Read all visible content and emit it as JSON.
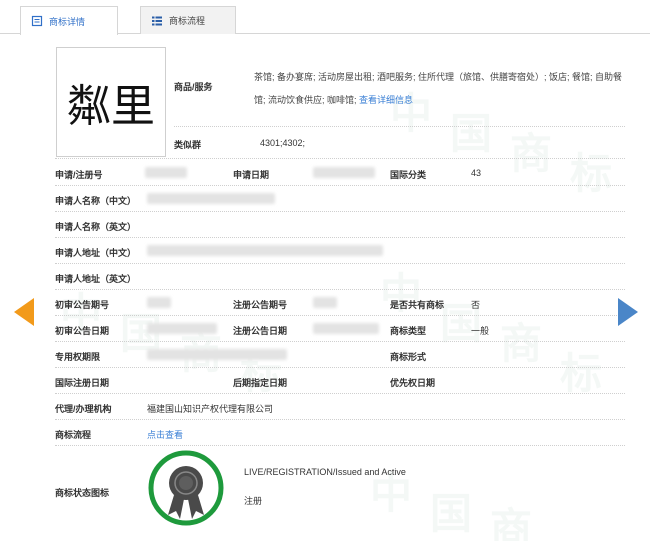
{
  "tabs": [
    {
      "label": "商标详情",
      "active": true
    },
    {
      "label": "商标流程",
      "active": false
    }
  ],
  "logo": {
    "text": "粼里"
  },
  "goods": {
    "label": "商品/服务",
    "text": "茶馆; 备办宴席; 活动房屋出租; 酒吧服务; 住所代理（旅馆、供膳寄宿处）; 饭店; 餐馆; 自助餐馆; 流动饮食供应; 咖啡馆; ",
    "link": "查看详细信息"
  },
  "similar_group": {
    "label": "类似群",
    "value": "4301;4302;"
  },
  "fields": {
    "reg_no_label": "申请/注册号",
    "apply_date_label": "申请日期",
    "intl_class_label": "国际分类",
    "intl_class_value": "43",
    "applicant_cn_label": "申请人名称（中文）",
    "applicant_en_label": "申请人名称（英文）",
    "address_cn_label": "申请人地址（中文）",
    "address_en_label": "申请人地址（英文）",
    "prelim_pub_no_label": "初审公告期号",
    "reg_pub_no_label": "注册公告期号",
    "shared_label": "是否共有商标",
    "shared_value": "否",
    "prelim_pub_date_label": "初审公告日期",
    "reg_pub_date_label": "注册公告日期",
    "tm_type_label": "商标类型",
    "tm_type_value": "一般",
    "exclusive_period_label": "专用权期限",
    "tm_form_label": "商标形式",
    "intl_reg_date_label": "国际注册日期",
    "later_date_label": "后期指定日期",
    "priority_date_label": "优先权日期",
    "agent_label": "代理/办理机构",
    "agent_value": "福建国山知识产权代理有限公司",
    "process_label": "商标流程",
    "process_link": "点击查看",
    "status_icon_label": "商标状态图标"
  },
  "status": {
    "en": "LIVE/REGISTRATION/Issued and Active",
    "cn": "注册",
    "ring_color": "#1e9a3c",
    "badge_color": "#4a4a4a"
  },
  "colors": {
    "link": "#3a7fd5",
    "arrow_left": "#f29a1a",
    "arrow_right": "#4a86c8",
    "active_tab": "#3070c8"
  },
  "watermark": "中国商标"
}
